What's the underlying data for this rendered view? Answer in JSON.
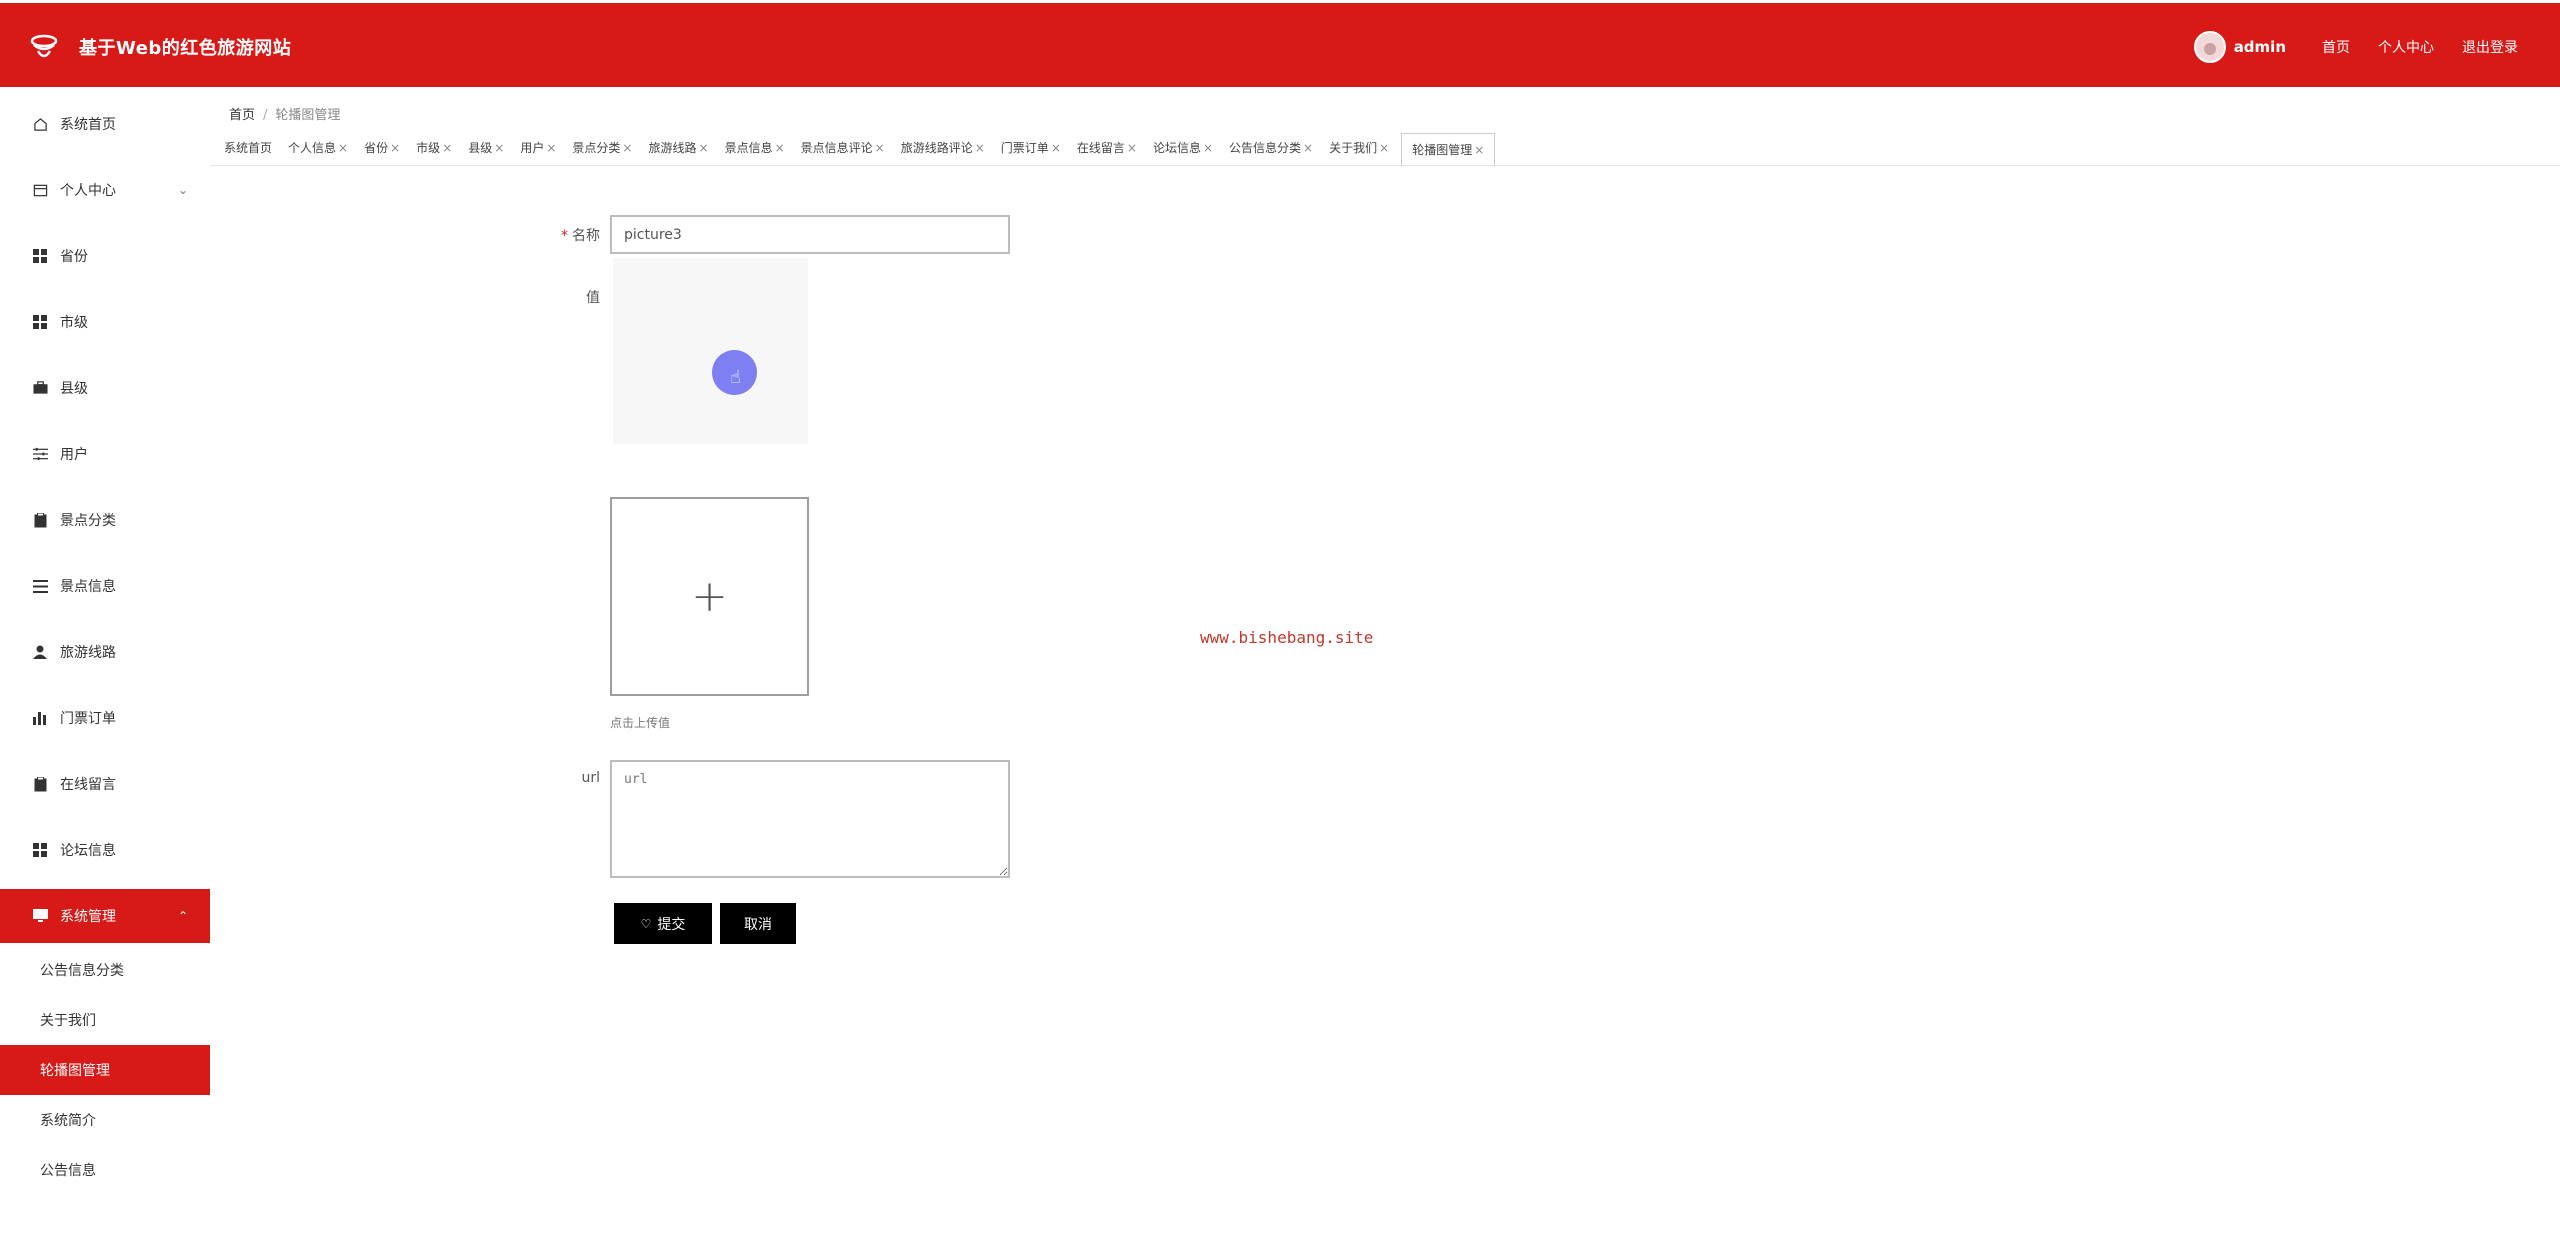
{
  "header": {
    "site_title": "基于Web的红色旅游网站",
    "username": "admin",
    "nav": [
      "首页",
      "个人中心",
      "退出登录"
    ],
    "bg_color": "#d71a18"
  },
  "sidebar": {
    "items": [
      {
        "label": "系统首页",
        "icon": "home-icon"
      },
      {
        "label": "个人中心",
        "icon": "user-card-icon"
      },
      {
        "label": "省份",
        "icon": "grid-icon"
      },
      {
        "label": "市级",
        "icon": "grid-icon"
      },
      {
        "label": "县级",
        "icon": "briefcase-icon"
      },
      {
        "label": "用户",
        "icon": "sliders-icon"
      },
      {
        "label": "景点分类",
        "icon": "clipboard-icon"
      },
      {
        "label": "景点信息",
        "icon": "list-icon"
      },
      {
        "label": "旅游线路",
        "icon": "person-icon"
      },
      {
        "label": "门票订单",
        "icon": "bar-chart-icon"
      },
      {
        "label": "在线留言",
        "icon": "clipboard-icon"
      },
      {
        "label": "论坛信息",
        "icon": "grid-icon"
      },
      {
        "label": "系统管理",
        "icon": "monitor-icon"
      }
    ],
    "subitems": [
      "公告信息分类",
      "关于我们",
      "轮播图管理",
      "系统简介",
      "公告信息"
    ]
  },
  "breadcrumb": {
    "home": "首页",
    "current": "轮播图管理"
  },
  "tabs": [
    "系统首页",
    "个人信息",
    "省份",
    "市级",
    "县级",
    "用户",
    "景点分类",
    "旅游线路",
    "景点信息",
    "景点信息评论",
    "旅游线路评论",
    "门票订单",
    "在线留言",
    "论坛信息",
    "公告信息分类",
    "关于我们",
    "轮播图管理"
  ],
  "form": {
    "name_label": "名称",
    "name_value": "picture3",
    "value_label": "值",
    "upload_hint": "点击上传值",
    "url_label": "url",
    "url_placeholder": "url",
    "submit_label": "提交",
    "cancel_label": "取消"
  },
  "watermark": "www.bishebang.site"
}
